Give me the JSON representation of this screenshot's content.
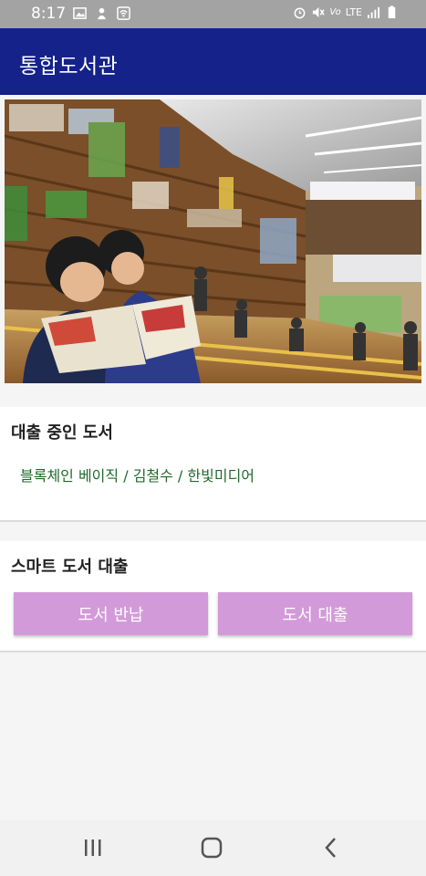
{
  "status_bar": {
    "time": "8:17",
    "network": "LTE"
  },
  "app_bar": {
    "title": "통합도서관"
  },
  "loan_section": {
    "heading": "대출 중인 도서",
    "book": "블록체인 베이직 / 김철수 / 한빛미디어"
  },
  "smart_section": {
    "heading": "스마트 도서 대출",
    "return_button": "도서 반납",
    "borrow_button": "도서 대출"
  },
  "colors": {
    "app_bar": "#15228a",
    "button": "#d39ad9",
    "book_text": "#1f6a2a"
  }
}
